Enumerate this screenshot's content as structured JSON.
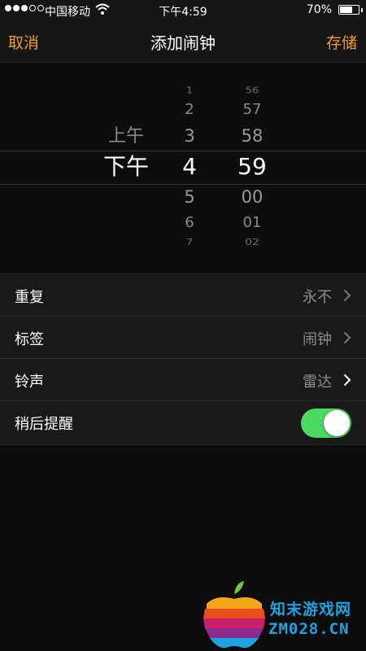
{
  "status_bar": {
    "carrier": "中国移动",
    "time": "下午4:59",
    "battery_percent": "70%",
    "battery_level": 0.7,
    "signal_bars": 3,
    "signal_total": 5
  },
  "nav": {
    "cancel_label": "取消",
    "title": "添加闹钟",
    "save_label": "存储",
    "accent_color": "#f09c24"
  },
  "picker": {
    "ampm": {
      "above": [
        "上午"
      ],
      "selected": "下午"
    },
    "hour": {
      "above": [
        "1",
        "2",
        "3"
      ],
      "selected": "4",
      "below": [
        "5",
        "6",
        "7"
      ]
    },
    "minute": {
      "above": [
        "56",
        "57",
        "58"
      ],
      "selected": "59",
      "below": [
        "00",
        "01",
        "02"
      ]
    }
  },
  "settings": {
    "repeat": {
      "label": "重复",
      "value": "永不"
    },
    "tag": {
      "label": "标签",
      "value": "闹钟"
    },
    "sound": {
      "label": "铃声",
      "value": "雷达"
    },
    "snooze": {
      "label": "稍后提醒",
      "enabled": true,
      "on_color": "#4cd964"
    }
  },
  "watermark": {
    "line1": "知末游戏网",
    "line2": "ZM028.CN"
  }
}
